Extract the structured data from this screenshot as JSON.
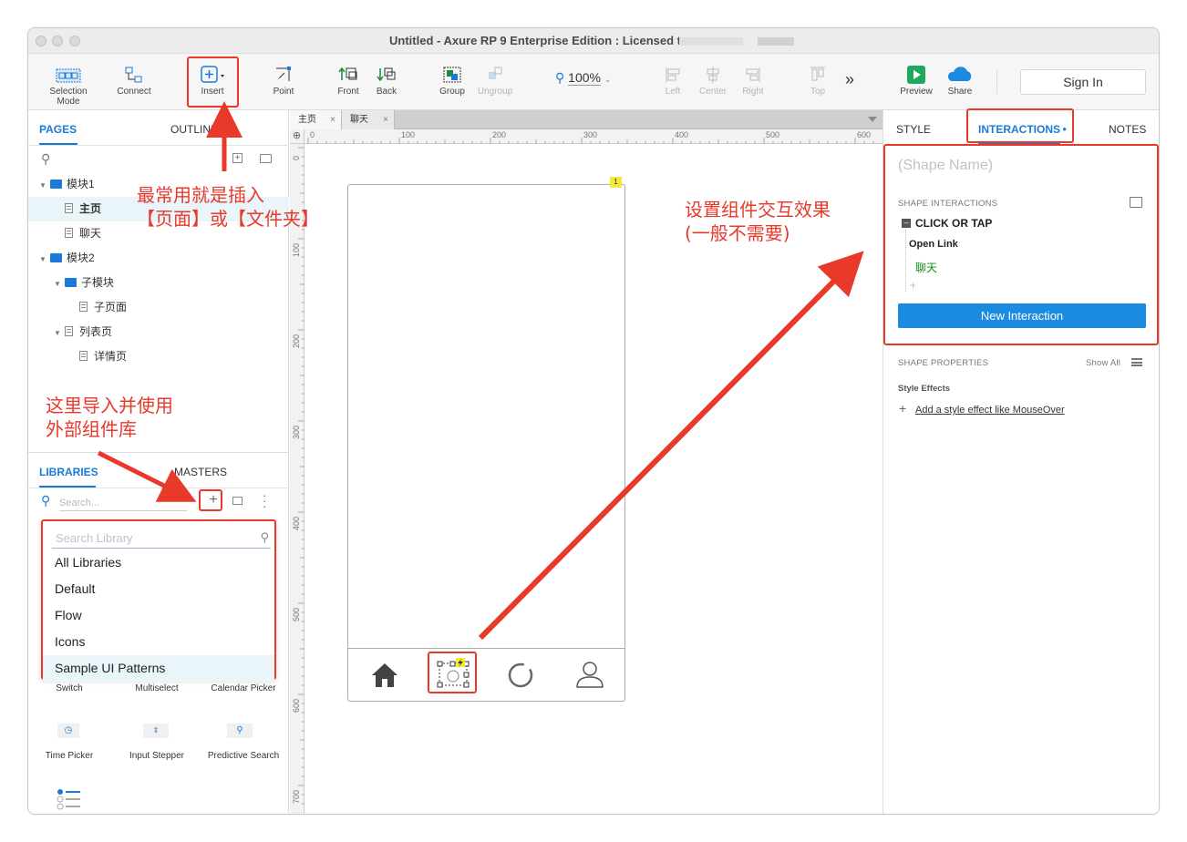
{
  "window": {
    "title": "Untitled - Axure RP 9 Enterprise Edition : Licensed to"
  },
  "toolbar": {
    "selection_mode": "Selection Mode",
    "connect": "Connect",
    "insert": "Insert",
    "point": "Point",
    "front": "Front",
    "back": "Back",
    "group": "Group",
    "ungroup": "Ungroup",
    "zoom": "100%",
    "left": "Left",
    "center": "Center",
    "right": "Right",
    "top": "Top",
    "more": "»",
    "preview": "Preview",
    "share": "Share",
    "sign_in": "Sign In"
  },
  "pages_panel": {
    "tab_pages": "PAGES",
    "tab_outline": "OUTLINE",
    "tree": [
      {
        "label": "模块1",
        "type": "folder",
        "level": 0,
        "expanded": true
      },
      {
        "label": "主页",
        "type": "page",
        "level": 1,
        "selected": true
      },
      {
        "label": "聊天",
        "type": "page",
        "level": 1
      },
      {
        "label": "模块2",
        "type": "folder",
        "level": 0,
        "expanded": true
      },
      {
        "label": "子模块",
        "type": "folder",
        "level": 1,
        "expanded": true
      },
      {
        "label": "子页面",
        "type": "page",
        "level": 2
      },
      {
        "label": "列表页",
        "type": "page",
        "level": 1,
        "expanded": true
      },
      {
        "label": "详情页",
        "type": "page",
        "level": 2
      }
    ]
  },
  "libraries_panel": {
    "tab_libraries": "LIBRARIES",
    "tab_masters": "MASTERS",
    "search_placeholder": "Search...",
    "dropdown_search_placeholder": "Search Library",
    "dropdown_options": [
      "All Libraries",
      "Default",
      "Flow",
      "Icons",
      "Sample UI Patterns"
    ],
    "widgets": [
      "Switch",
      "Multiselect",
      "Calendar Picker",
      "Time Picker",
      "Input Stepper",
      "Predictive Search"
    ]
  },
  "canvas": {
    "tabs": [
      "主页",
      "聊天"
    ],
    "ruler_h": [
      "0",
      "100",
      "200",
      "300",
      "400",
      "500",
      "600"
    ],
    "ruler_v": [
      "0",
      "100",
      "200",
      "300",
      "400",
      "500",
      "600",
      "700"
    ],
    "note_badge": "1"
  },
  "inspector": {
    "tab_style": "STYLE",
    "tab_interactions": "INTERACTIONS",
    "tab_notes": "NOTES",
    "shape_name_placeholder": "(Shape Name)",
    "shape_interactions": "SHAPE INTERACTIONS",
    "event": "CLICK OR TAP",
    "action": "Open Link",
    "target": "聊天",
    "add": "+",
    "new_interaction": "New Interaction",
    "shape_properties": "SHAPE PROPERTIES",
    "show_all": "Show All",
    "style_effects": "Style Effects",
    "add_style_effect": "Add a style effect like MouseOver"
  },
  "annotations": {
    "insert_note_line1": "最常用就是插入",
    "insert_note_line2": "【页面】或【文件夹】",
    "library_note_line1": "这里导入并使用",
    "library_note_line2": "外部组件库",
    "interaction_note_line1": "设置组件交互效果",
    "interaction_note_line2": "(一般不需要)"
  },
  "colors": {
    "accent": "#1a7bd6",
    "button": "#1a8be0",
    "annotation": "#e8392b",
    "preview": "#1fa95b"
  }
}
